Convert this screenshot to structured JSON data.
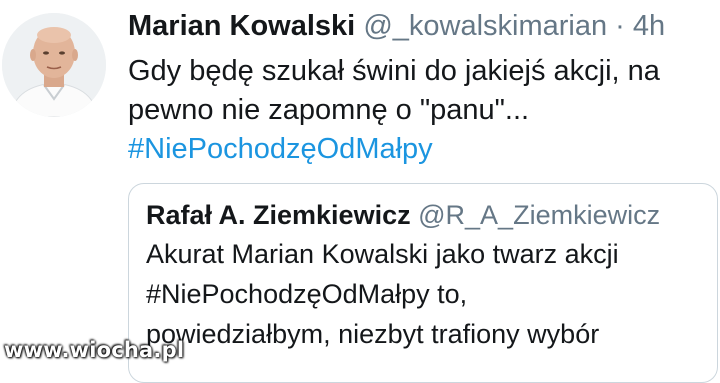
{
  "tweet": {
    "author_name": "Marian Kowalski",
    "author_handle": "@_kowalskimarian",
    "separator": "·",
    "timestamp": "4h",
    "text_line_1": "Gdy będę szukał świni do jakiejś akcji, na",
    "text_line_2": "pewno nie zapomnę o \"panu\"...",
    "hashtag": "#NiePochodzęOdMałpy",
    "avatar_icon": "person-portrait-avatar"
  },
  "quoted_tweet": {
    "author_name": "Rafał A. Ziemkiewicz",
    "author_handle": "@R_A_Ziemkiewicz",
    "text_line_1": "Akurat Marian Kowalski jako twarz akcji",
    "text_line_2": "#NiePochodzęOdMałpy to,",
    "text_line_3": "powiedziałbym, niezbyt trafiony wybór"
  },
  "watermark": "www.wiocha.pl",
  "colors": {
    "text": "#14171a",
    "secondary_text": "#657786",
    "link": "#1b95e0",
    "border": "#ccd6dd"
  }
}
